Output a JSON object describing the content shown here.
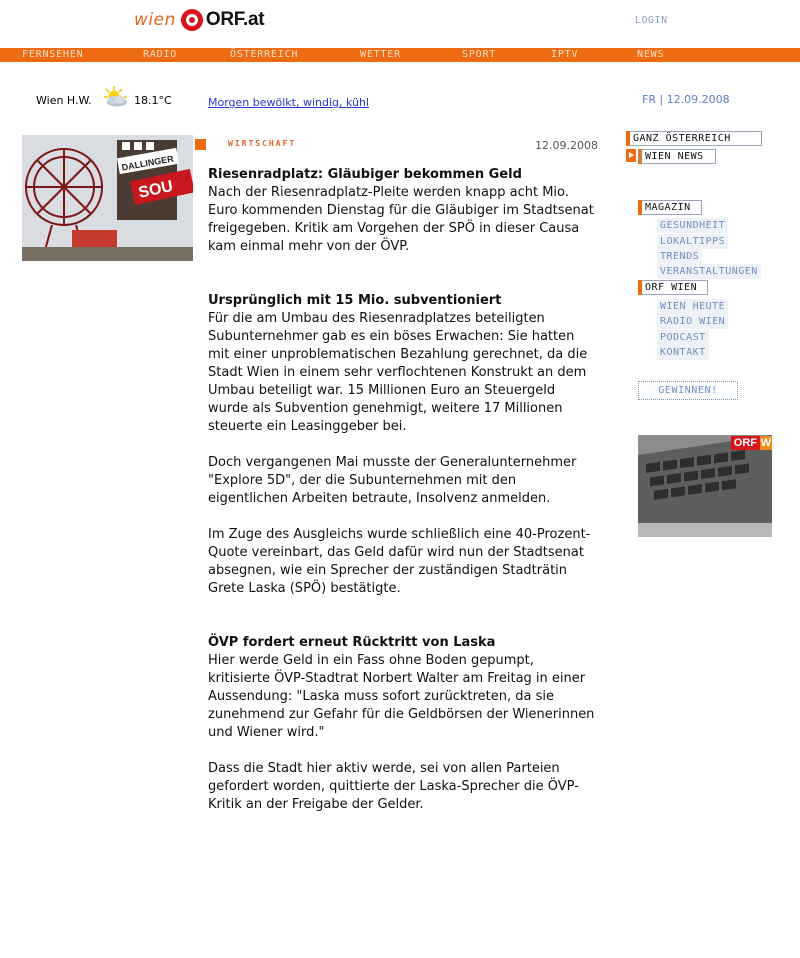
{
  "header": {
    "logo_wien": "wien",
    "logo_orf": "ORF.at",
    "login": "LOGIN"
  },
  "nav": {
    "items": [
      "FERNSEHEN",
      "RADIO",
      "ÖSTERREICH",
      "WETTER",
      "SPORT",
      "IPTV",
      "NEWS"
    ]
  },
  "weather": {
    "location": "Wien H.W.",
    "icon": "partly-cloudy-icon",
    "temperature": "18.1°C",
    "forecast": "Morgen bewölkt, windig, kühl",
    "date": "FR | 12.09.2008"
  },
  "article": {
    "category": "WIRTSCHAFT",
    "date": "12.09.2008",
    "title": "Riesenradplatz: Gläubiger bekommen Geld",
    "lead": "Nach der Riesenradplatz-Pleite werden knapp acht Mio. Euro kommenden Dienstag für die Gläubiger im Stadtsenat freigegeben. Kritik am Vorgehen der SPÖ in dieser Causa kam einmal mehr von der ÖVP.",
    "sub1": "Ursprünglich mit 15 Mio. subventioniert",
    "p1": "Für die am Umbau des Riesenradplatzes beteiligten Subunternehmer gab es ein böses Erwachen: Sie hatten mit einer unproblematischen Bezahlung gerechnet, da die Stadt Wien in einem sehr verflochtenen Konstrukt an dem Umbau beteiligt war. 15 Millionen Euro an Steuergeld wurde als Subvention genehmigt, weitere 17 Millionen steuerte ein Leasinggeber bei.",
    "p2": "Doch vergangenen Mai musste der Generalunternehmer \"Explore 5D\", der die Subunternehmen mit den eigentlichen Arbeiten betraute, Insolvenz anmelden.",
    "p3": "Im Zuge des Ausgleichs wurde schließlich eine 40-Prozent-Quote vereinbart, das Geld dafür wird nun der Stadtsenat absegnen, wie ein Sprecher der zuständigen Stadträtin Grete Laska (SPÖ) bestätigte.",
    "sub2": "ÖVP fordert erneut Rücktritt von Laska",
    "p4": "Hier werde Geld in ein Fass ohne Boden gepumpt, kritisierte ÖVP-Stadtrat Norbert Walter am Freitag in einer Aussendung: \"Laska muss sofort zurücktreten, da sie zunehmend zur Gefahr für die Geldbörsen der Wienerinnen und Wiener wird.\"",
    "p5": "Dass die Stadt hier aktiv werde, sei von allen Parteien gefordert worden, quittierte der Laska-Sprecher die ÖVP-Kritik an der Freigabe der Gelder."
  },
  "photo": {
    "sign1": "DALLINGER",
    "sign2": "SOU"
  },
  "sidebar": {
    "ganz_oesterreich": "GANZ ÖSTERREICH",
    "wien_news": "WIEN NEWS",
    "magazin": "MAGAZIN",
    "magazin_items": [
      "GESUNDHEIT",
      "LOKALTIPPS",
      "TRENDS",
      "VERANSTALTUNGEN"
    ],
    "orf_wien": "ORF WIEN",
    "orf_wien_items": [
      "WIEN HEUTE",
      "RADIO WIEN",
      "PODCAST",
      "KONTAKT"
    ],
    "gewinnen": "GEWINNEN!",
    "promo_orf": "ORF",
    "promo_w": "W"
  },
  "colors": {
    "accent": "#ef6b12",
    "link": "#2a39d6",
    "sidebar_link": "#6f8fc3"
  }
}
